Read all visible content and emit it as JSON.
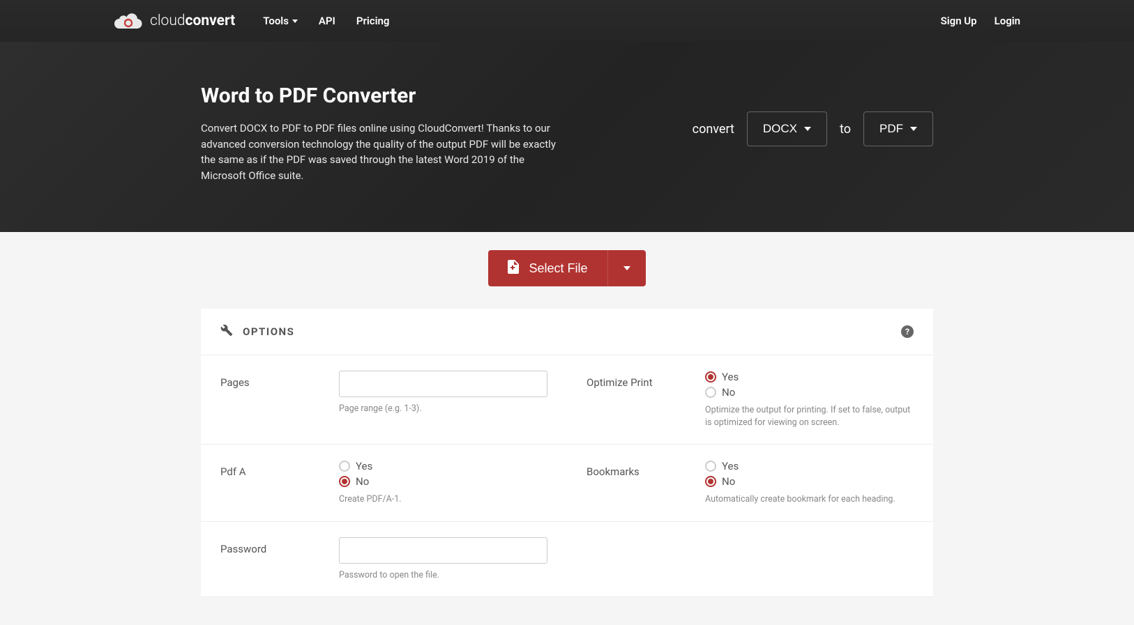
{
  "brand": {
    "name_light": "cloud",
    "name_bold": "convert"
  },
  "nav": {
    "tools": "Tools",
    "api": "API",
    "pricing": "Pricing",
    "signup": "Sign Up",
    "login": "Login"
  },
  "hero": {
    "title": "Word to PDF Converter",
    "description": "Convert DOCX to PDF to PDF files online using CloudConvert! Thanks to our advanced conversion technology the quality of the output PDF will be exactly the same as if the PDF was saved through the latest Word 2019 of the Microsoft Office suite.",
    "convert_label": "convert",
    "to_label": "to",
    "from_format": "DOCX",
    "to_format": "PDF"
  },
  "select_file": "Select File",
  "options": {
    "title": "OPTIONS",
    "pages": {
      "label": "Pages",
      "value": "",
      "help": "Page range (e.g. 1-3)."
    },
    "optimize_print": {
      "label": "Optimize Print",
      "yes": "Yes",
      "no": "No",
      "value": "yes",
      "help": "Optimize the output for printing. If set to false, output is optimized for viewing on screen."
    },
    "pdf_a": {
      "label": "Pdf A",
      "yes": "Yes",
      "no": "No",
      "value": "no",
      "help": "Create PDF/A-1."
    },
    "bookmarks": {
      "label": "Bookmarks",
      "yes": "Yes",
      "no": "No",
      "value": "no",
      "help": "Automatically create bookmark for each heading."
    },
    "password": {
      "label": "Password",
      "value": "",
      "help": "Password to open the file."
    }
  }
}
